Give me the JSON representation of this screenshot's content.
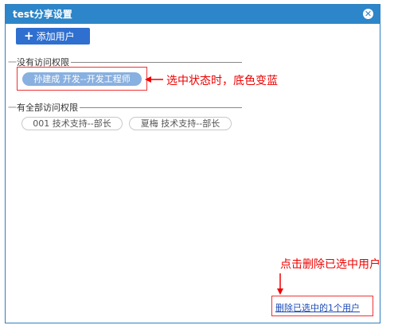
{
  "dialog": {
    "title": "test分享设置",
    "close_icon": "close-icon"
  },
  "toolbar": {
    "add_label": "添加用户",
    "add_icon": "plus-icon"
  },
  "no_access": {
    "title": "没有访问权限",
    "users": [
      {
        "label": "孙建成 开发--开发工程师",
        "selected": true
      }
    ]
  },
  "full_access": {
    "title": "有全部访问权限",
    "users": [
      {
        "label": "001 技术支持--部长",
        "selected": false
      },
      {
        "label": "夏梅 技术支持--部长",
        "selected": false
      }
    ]
  },
  "annotations": {
    "selected_note": "选中状态时，底色变蓝",
    "delete_note": "点击删除已选中用户"
  },
  "footer": {
    "delete_link": "删除已选中的1个用户"
  },
  "colors": {
    "title_bar": "#2d86c9",
    "add_button": "#2f6fcf",
    "selected_tag": "#88b0e0",
    "annotation_red": "#e00000"
  }
}
